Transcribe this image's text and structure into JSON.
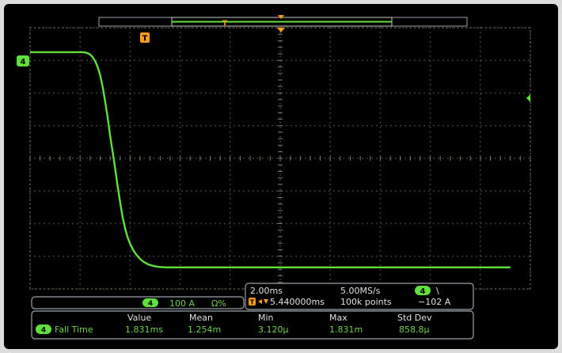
{
  "chart_data": {
    "type": "line",
    "x_divisions": 10,
    "y_divisions": 8,
    "grid": true,
    "x_div_per_point": 0.05,
    "series": [
      {
        "channel": "4",
        "color": "#5fe03a",
        "y_div": [
          3.25,
          3.25,
          3.25,
          3.25,
          3.25,
          3.25,
          3.25,
          3.25,
          3.25,
          3.25,
          3.25,
          3.25,
          3.25,
          3.25,
          3.25,
          3.25,
          3.25,
          3.25,
          3.25,
          3.25,
          3.25,
          3.25,
          3.24,
          3.22,
          3.18,
          3.1,
          2.98,
          2.8,
          2.55,
          2.2,
          1.75,
          1.25,
          0.7,
          0.2,
          -0.3,
          -0.85,
          -1.35,
          -1.8,
          -2.15,
          -2.42,
          -2.62,
          -2.78,
          -2.9,
          -3,
          -3.08,
          -3.15,
          -3.2,
          -3.24,
          -3.27,
          -3.29,
          -3.31,
          -3.32,
          -3.33,
          -3.33,
          -3.34,
          -3.34,
          -3.34,
          -3.34,
          -3.34,
          -3.34,
          -3.34,
          -3.34,
          -3.34,
          -3.34,
          -3.34,
          -3.34,
          -3.34,
          -3.34,
          -3.34,
          -3.34,
          -3.34,
          -3.34,
          -3.34,
          -3.34,
          -3.34,
          -3.34,
          -3.34,
          -3.34,
          -3.34,
          -3.34,
          -3.34,
          -3.34,
          -3.34,
          -3.34,
          -3.34,
          -3.34,
          -3.34,
          -3.34,
          -3.34,
          -3.34,
          -3.34,
          -3.34,
          -3.34,
          -3.34,
          -3.34,
          -3.34,
          -3.34,
          -3.34,
          -3.34,
          -3.34,
          -3.34,
          -3.34,
          -3.34,
          -3.34,
          -3.34,
          -3.34,
          -3.34,
          -3.34,
          -3.34,
          -3.34,
          -3.34,
          -3.34,
          -3.34,
          -3.34,
          -3.34,
          -3.34,
          -3.34,
          -3.34,
          -3.34,
          -3.34,
          -3.34,
          -3.34,
          -3.34,
          -3.34,
          -3.34,
          -3.34,
          -3.34,
          -3.34,
          -3.34,
          -3.34,
          -3.34,
          -3.34,
          -3.34,
          -3.34,
          -3.34,
          -3.34,
          -3.34,
          -3.34,
          -3.34,
          -3.34,
          -3.34,
          -3.34,
          -3.34,
          -3.34,
          -3.34,
          -3.34,
          -3.34,
          -3.34,
          -3.34,
          -3.34,
          -3.34,
          -3.34,
          -3.34,
          -3.34,
          -3.34,
          -3.34,
          -3.34,
          -3.34,
          -3.34,
          -3.34,
          -3.34,
          -3.34,
          -3.34,
          -3.34,
          -3.34,
          -3.34,
          -3.34,
          -3.34,
          -3.34,
          -3.34,
          -3.34,
          -3.34,
          -3.34,
          -3.34,
          -3.34,
          -3.34,
          -3.34,
          -3.34,
          -3.34,
          -3.34,
          -3.34,
          -3.34,
          -3.34,
          -3.34,
          -3.34,
          -3.34,
          -3.34,
          -3.34,
          -3.34,
          -3.34,
          -3.34,
          -3.34,
          -3.34
        ]
      }
    ]
  },
  "markers": {
    "channel_marker": "4",
    "trigger_marker": "T"
  },
  "channel_bar": {
    "channel": "4",
    "scale": "100 A",
    "coupling": "Ω%"
  },
  "acquisition": {
    "time_div": "2.00ms",
    "sample_rate": "5.00MS/s",
    "trigger_channel": "4",
    "trigger_slope": "\\",
    "delay": "5.440000ms",
    "record_length": "100k points",
    "trigger_level": "−102 A"
  },
  "measurement": {
    "headers": [
      "Value",
      "Mean",
      "Min",
      "Max",
      "Std Dev"
    ],
    "channel": "4",
    "name": "Fall Time",
    "values": [
      "1.831ms",
      "1.254m",
      "3.120μ",
      "1.831m",
      "858.8μ"
    ]
  },
  "colors": {
    "trace": "#5fe03a",
    "grid": "#5a5a4a",
    "frame": "#9aa2aa",
    "accent": "#ff9a1a",
    "text": "#e0e0e0"
  }
}
